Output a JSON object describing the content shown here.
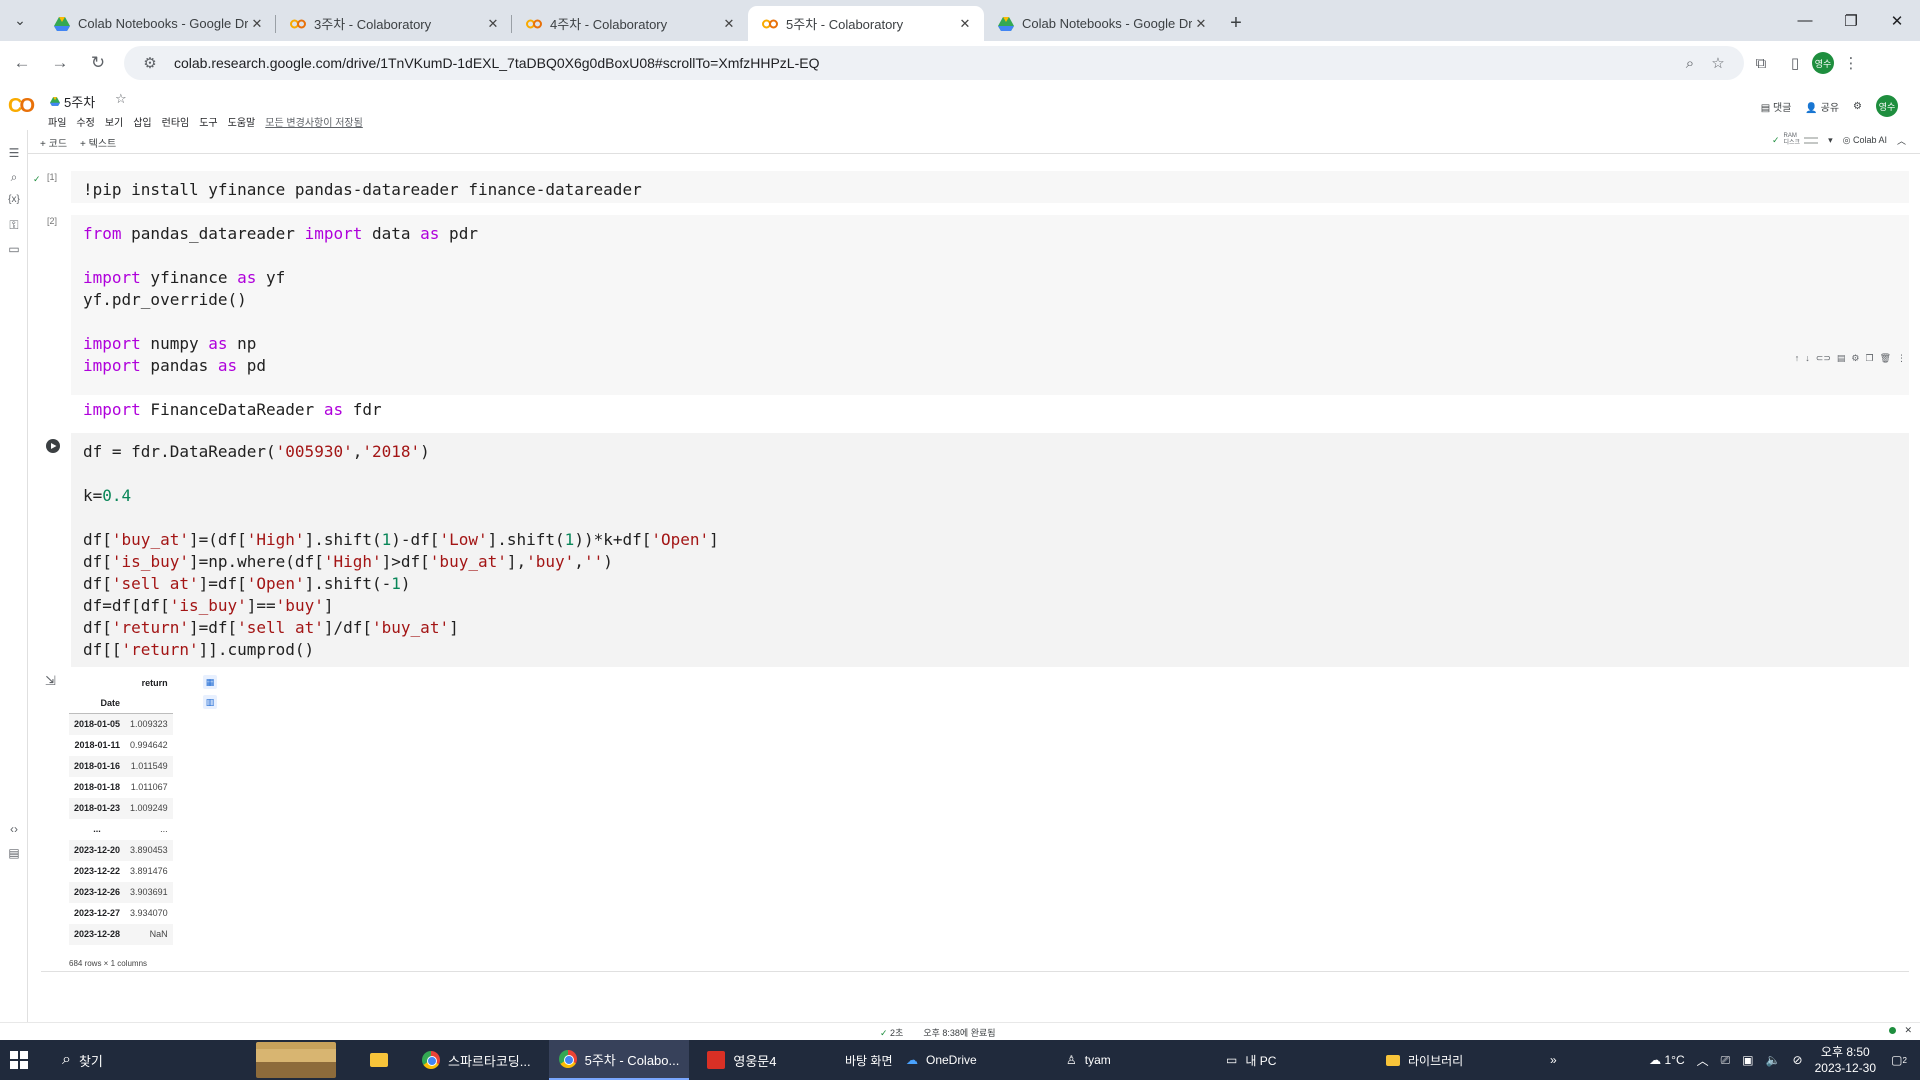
{
  "browser": {
    "tabs": [
      {
        "label": "Colab Notebooks - Google Dr",
        "icon": "drive-icon"
      },
      {
        "label": "3주차 - Colaboratory",
        "icon": "colab-icon"
      },
      {
        "label": "4주차 - Colaboratory",
        "icon": "colab-icon"
      },
      {
        "label": "5주차 - Colaboratory",
        "icon": "colab-icon",
        "active": true
      },
      {
        "label": "Colab Notebooks - Google Dr",
        "icon": "drive-icon"
      }
    ],
    "url": "colab.research.google.com/drive/1TnVKumD-1dEXL_7taDBQ0X6g0dBoxU08#scrollTo=XmfzHHPzL-EQ",
    "profile_initials": "영수"
  },
  "colab": {
    "notebook_title": "5주차",
    "menu": [
      "파일",
      "수정",
      "보기",
      "삽입",
      "런타임",
      "도구",
      "도움말"
    ],
    "saved_text": "모든 변경사항이 저장됨",
    "header_right": {
      "comment": "댓글",
      "share": "공유",
      "avatar": "영수"
    },
    "toolbar": {
      "add_code": "+ 코드",
      "add_text": "+ 텍스트",
      "ram_label": "RAM",
      "disk_label": "디스크",
      "colab_ai": "Colab AI"
    }
  },
  "cells": [
    {
      "exec_count": "[1]"
    },
    {
      "exec_count": "[2]"
    },
    {
      "exec_count": ""
    }
  ],
  "output": {
    "columns": [
      "return"
    ],
    "index_name": "Date",
    "rows": [
      {
        "date": "2018-01-05",
        "value": "1.009323"
      },
      {
        "date": "2018-01-11",
        "value": "0.994642"
      },
      {
        "date": "2018-01-16",
        "value": "1.011549"
      },
      {
        "date": "2018-01-18",
        "value": "1.011067"
      },
      {
        "date": "2018-01-23",
        "value": "1.009249"
      },
      {
        "date": "...",
        "value": "..."
      },
      {
        "date": "2023-12-20",
        "value": "3.890453"
      },
      {
        "date": "2023-12-22",
        "value": "3.891476"
      },
      {
        "date": "2023-12-26",
        "value": "3.903691"
      },
      {
        "date": "2023-12-27",
        "value": "3.934070"
      },
      {
        "date": "2023-12-28",
        "value": "NaN"
      }
    ],
    "shape": "684 rows × 1 columns"
  },
  "status": {
    "time": "2초",
    "completed": "오후 8:38에 완료됨"
  },
  "taskbar": {
    "search_label": "찾기",
    "apps": [
      {
        "label": "스파르타코딩..."
      },
      {
        "label": "5주차 - Colabo...",
        "active": true
      },
      {
        "label": "영웅문4"
      }
    ],
    "desktop_label": "바탕 화면",
    "onedrive": "OneDrive",
    "user": "tyam",
    "mypc": "내 PC",
    "library": "라이브러리",
    "weather": "1°C",
    "time": "오후 8:50",
    "date": "2023-12-30",
    "notif_count": "2"
  }
}
